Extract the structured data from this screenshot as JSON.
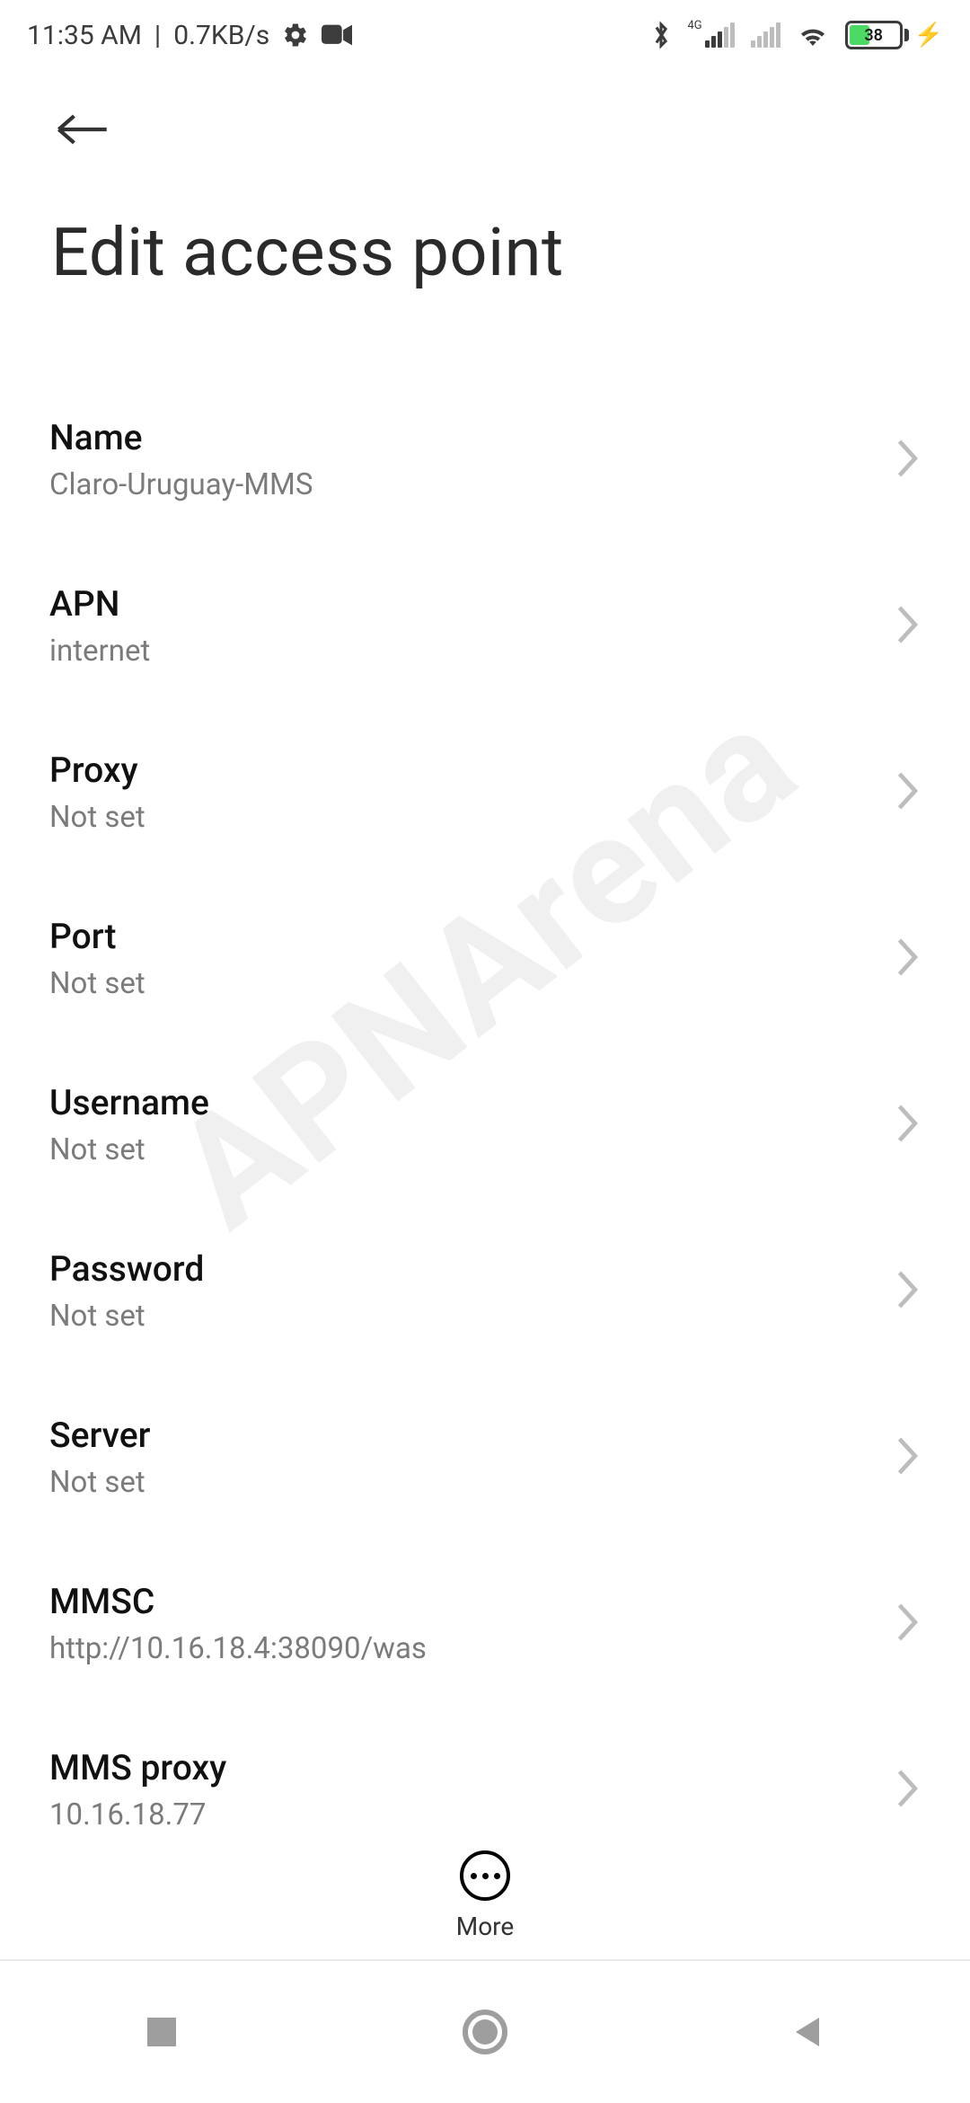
{
  "status": {
    "time": "11:35 AM",
    "separator": "|",
    "net_speed": "0.7KB/s",
    "mobile_gen": "4G",
    "battery_pct": "38"
  },
  "header": {
    "title": "Edit access point"
  },
  "settings": [
    {
      "label": "Name",
      "value": "Claro-Uruguay-MMS"
    },
    {
      "label": "APN",
      "value": "internet"
    },
    {
      "label": "Proxy",
      "value": "Not set"
    },
    {
      "label": "Port",
      "value": "Not set"
    },
    {
      "label": "Username",
      "value": "Not set"
    },
    {
      "label": "Password",
      "value": "Not set"
    },
    {
      "label": "Server",
      "value": "Not set"
    },
    {
      "label": "MMSC",
      "value": "http://10.16.18.4:38090/was"
    },
    {
      "label": "MMS proxy",
      "value": "10.16.18.77"
    }
  ],
  "more": {
    "label": "More"
  }
}
